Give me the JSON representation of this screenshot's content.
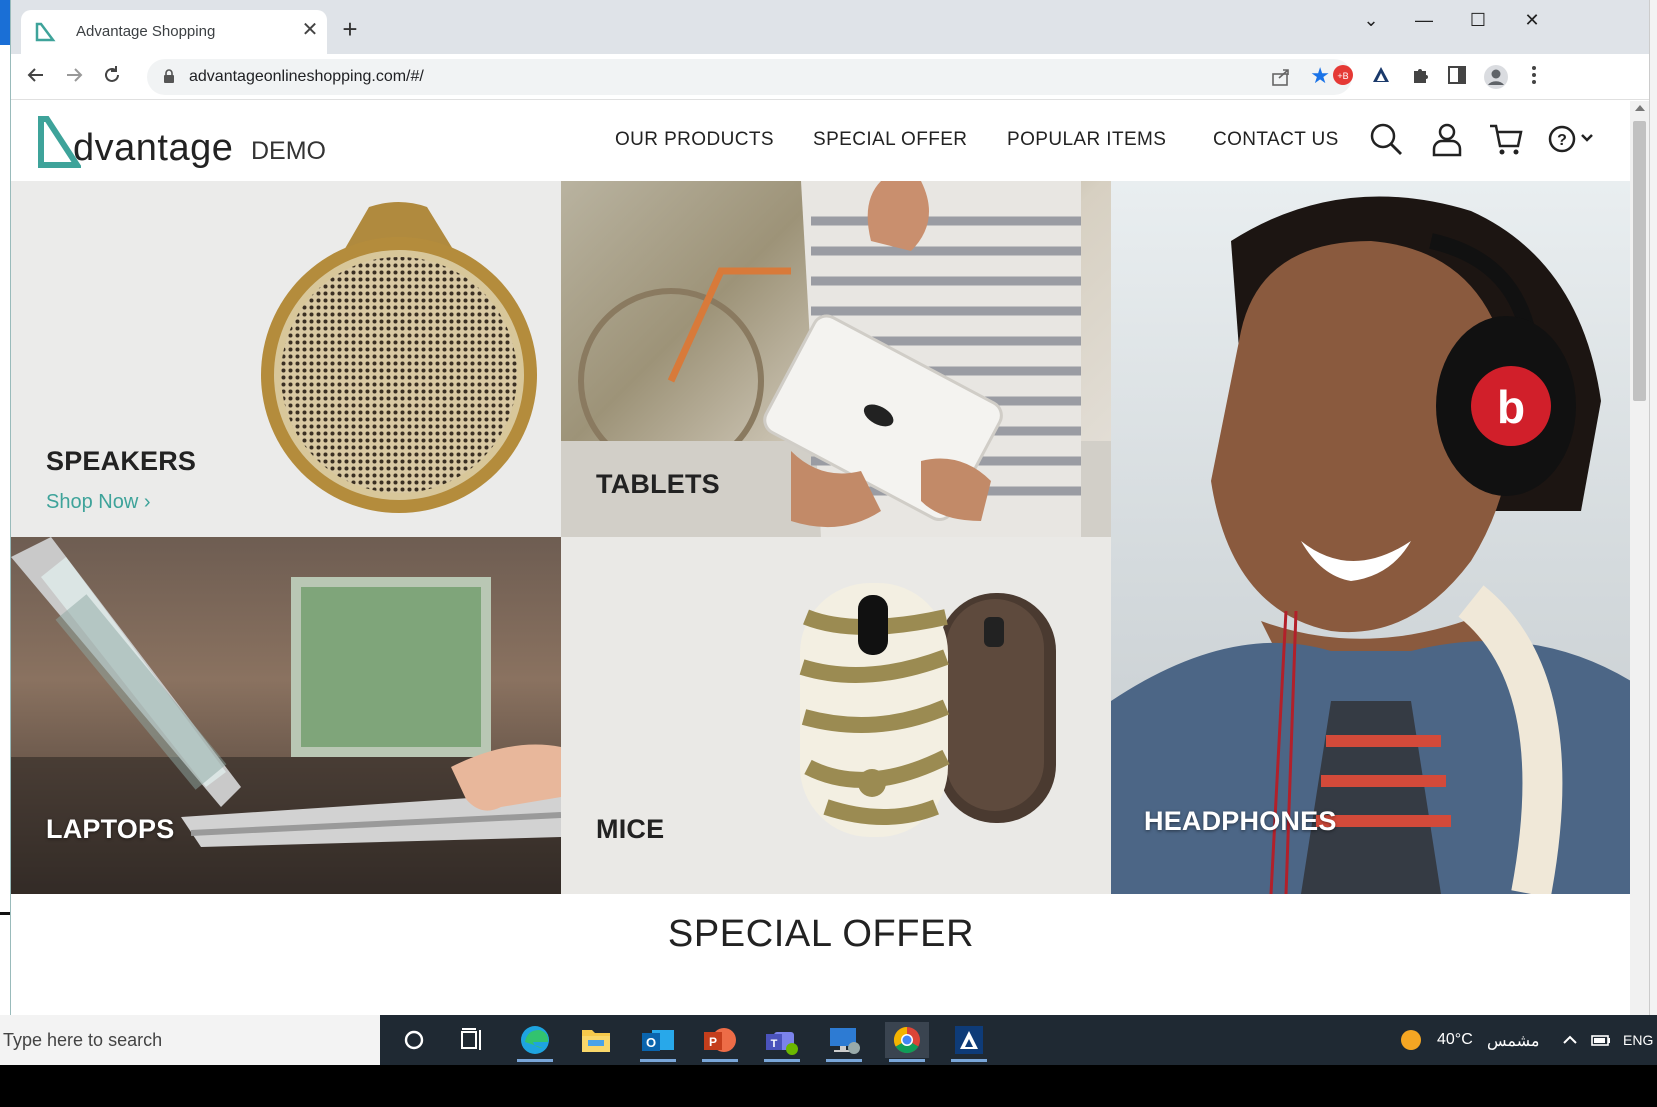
{
  "browser": {
    "tab_title": "Advantage Shopping",
    "tab_close": "✕",
    "new_tab": "+",
    "url": "advantageonlineshopping.com/#/",
    "window_controls": [
      "⌄",
      "—",
      "☐",
      "✕"
    ]
  },
  "site": {
    "logo_word": "dvantage",
    "logo_demo": "DEMO",
    "nav": [
      "OUR PRODUCTS",
      "SPECIAL OFFER",
      "POPULAR ITEMS",
      "CONTACT US"
    ],
    "header_icons": [
      "search-icon",
      "user-icon",
      "cart-icon",
      "help-icon"
    ]
  },
  "categories": {
    "speakers": "SPEAKERS",
    "shop_now": "Shop Now",
    "tablets": "TABLETS",
    "headphones": "HEADPHONES",
    "laptops": "LAPTOPS",
    "mice": "MICE"
  },
  "special_offer_title": "SPECIAL OFFER",
  "taskbar": {
    "search_placeholder": "Type here to search",
    "temperature": "40°C",
    "weather": "مشمس",
    "language": "ENG",
    "apps": [
      "cortana-icon",
      "task-view-icon",
      "edge-icon",
      "file-explorer-icon",
      "outlook-icon",
      "powerpoint-icon",
      "teams-icon",
      "remote-desktop-icon",
      "chrome-icon",
      "advantage-app-icon"
    ]
  },
  "colors": {
    "accent": "#3ea39a",
    "chrome_tab_bg": "#dfe3e8",
    "taskbar": "#1f2933"
  }
}
